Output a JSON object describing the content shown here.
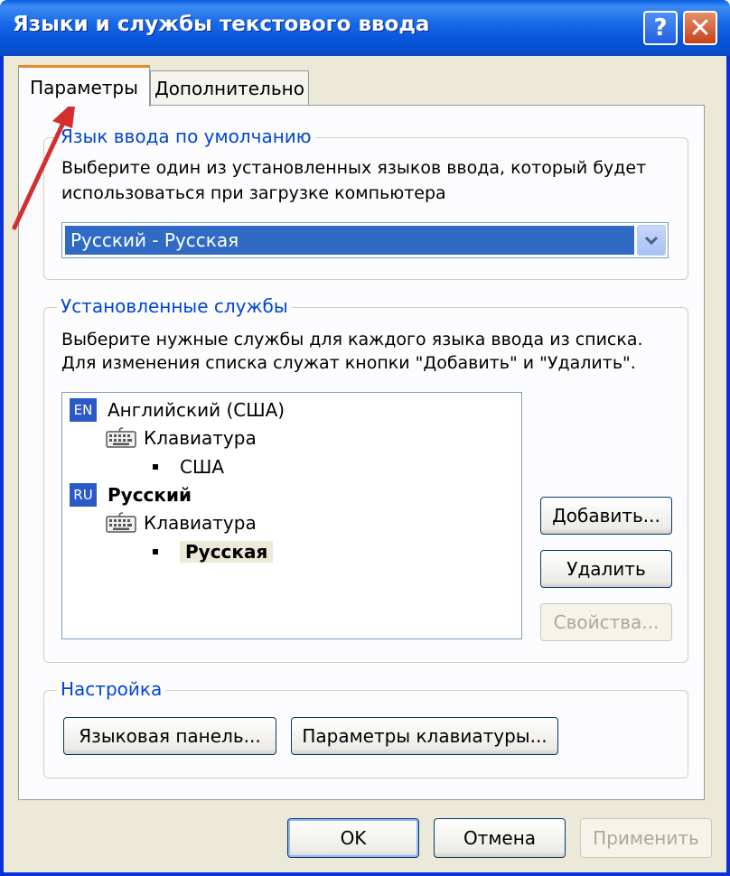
{
  "window": {
    "title": "Языки и службы текстового ввода",
    "help_label": "?",
    "close_label": "✕"
  },
  "tabs": [
    {
      "label": "Параметры",
      "active": true
    },
    {
      "label": "Дополнительно",
      "active": false
    }
  ],
  "default_language": {
    "legend": "Язык ввода по умолчанию",
    "description_line1": "Выберите один из установленных языков ввода, который будет",
    "description_line2": "использоваться при загрузке компьютера",
    "selected": "Русский - Русская"
  },
  "installed_services": {
    "legend": "Установленные службы",
    "description_line1": "Выберите нужные службы для каждого языка ввода из списка.",
    "description_line2": "Для изменения списка служат кнопки \"Добавить\" и \"Удалить\".",
    "tree": {
      "en": {
        "badge": "EN",
        "name": "Английский (США)",
        "service": "Клавиатура",
        "layout": "США"
      },
      "ru": {
        "badge": "RU",
        "name": "Русский",
        "service": "Клавиатура",
        "layout": "Русская"
      }
    },
    "add_label": "Добавить...",
    "remove_label": "Удалить",
    "properties_label": "Свойства..."
  },
  "settings": {
    "legend": "Настройка",
    "language_bar_label": "Языковая панель...",
    "keyboard_settings_label": "Параметры клавиатуры..."
  },
  "footer": {
    "ok_label": "OK",
    "cancel_label": "Отмена",
    "apply_label": "Применить"
  },
  "colors": {
    "title_bar": "#0a5fe3",
    "legend_text": "#0046d5",
    "selection": "#316ac5",
    "annotation_arrow": "#d32f2f"
  },
  "icons": {
    "keyboard": "keyboard-icon",
    "dropdown": "chevron-down-icon"
  }
}
